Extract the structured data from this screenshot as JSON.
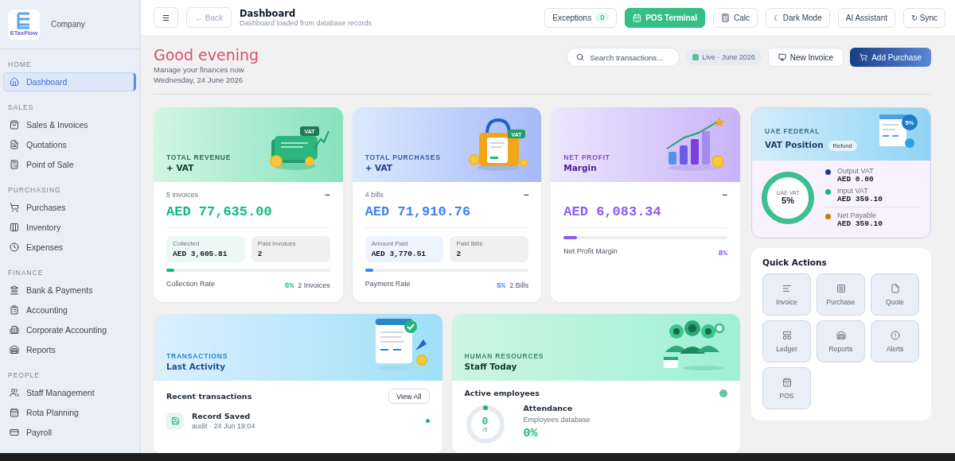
{
  "sidebar": {
    "logo_text": "ETaxFlow",
    "company": "Company",
    "sections": [
      {
        "label": "HOME",
        "items": [
          {
            "label": "Dashboard",
            "selected": true
          }
        ]
      },
      {
        "label": "SALES",
        "items": [
          {
            "label": "Sales & Invoices",
            "selected": false
          },
          {
            "label": "Quotations",
            "selected": false
          },
          {
            "label": "Point of Sale",
            "selected": false
          }
        ]
      },
      {
        "label": "PURCHASING",
        "items": [
          {
            "label": "Purchases",
            "selected": false
          },
          {
            "label": "Inventory",
            "selected": false
          },
          {
            "label": "Expenses",
            "selected": false
          }
        ]
      },
      {
        "label": "FINANCE",
        "items": [
          {
            "label": "Bank & Payments",
            "selected": false
          },
          {
            "label": "Accounting",
            "selected": false
          },
          {
            "label": "Corporate Accounting",
            "selected": false
          },
          {
            "label": "Reports",
            "selected": false
          }
        ]
      },
      {
        "label": "PEOPLE",
        "items": [
          {
            "label": "Staff Management",
            "selected": false
          },
          {
            "label": "Rota Planning",
            "selected": false
          },
          {
            "label": "Payroll",
            "selected": false
          }
        ]
      }
    ]
  },
  "topbar": {
    "menu": "☰",
    "back": "← Back",
    "title": "Dashboard",
    "subtitle": "Dashboard loaded from database records",
    "buttons": [
      {
        "label": "Exceptions",
        "kind": "outline",
        "badge": "0"
      },
      {
        "label": "POS Terminal",
        "kind": "primary"
      },
      {
        "label": "Calc",
        "kind": "outline"
      },
      {
        "label": "☾ Dark Mode",
        "kind": "outline"
      },
      {
        "label": "AI Assistant",
        "kind": "outline"
      },
      {
        "label": "↻ Sync",
        "kind": "outline"
      }
    ]
  },
  "greeting": {
    "title": "Good evening",
    "subtitle": "Manage your finances now",
    "date": "Wednesday, 24 June 2026"
  },
  "actions": {
    "search_placeholder": "Search transactions...",
    "live": "Live · June 2026",
    "new_invoice": "New Invoice",
    "add_purchase": "Add Purchase"
  },
  "stat_cards": [
    {
      "kind": "revenue",
      "eyebrow": "TOTAL REVENUE",
      "title": "+ VAT",
      "tag": "VAT",
      "count": "5 invoices",
      "toggle": "−",
      "value": "AED 77,635.00",
      "color": "#10b981",
      "tiles": [
        {
          "label": "Collected",
          "value": "AED 3,605.81"
        },
        {
          "label": "Paid Invoices",
          "value": "2"
        }
      ],
      "progress": {
        "level": 0.05,
        "label": "Collection Rate",
        "percent": "5%",
        "note": "2 Invoices"
      }
    },
    {
      "kind": "purchases",
      "eyebrow": "TOTAL PURCHASES",
      "title": "+ VAT",
      "tag": "VAT",
      "count": "4 bills",
      "toggle": "−",
      "value": "AED 71,910.76",
      "color": "#3b82f6",
      "tiles": [
        {
          "label": "Amount Paid",
          "value": "AED 3,770.51"
        },
        {
          "label": "Paid Bills",
          "value": "2"
        }
      ],
      "progress": {
        "level": 0.05,
        "label": "Payment Rate",
        "percent": "5%",
        "note": "2 Bills"
      }
    },
    {
      "kind": "profit",
      "eyebrow": "NET PROFIT",
      "title": "Margin",
      "toggle": "−",
      "value": "AED 6,083.34",
      "color": "#8b5cf6",
      "progress": {
        "level": 0.08,
        "label": "Net Profit Margin",
        "percent": "8%"
      }
    }
  ],
  "vat": {
    "eyebrow": "UAE FEDERAL",
    "title": "VAT Position",
    "badge": "Refund",
    "tag": "5%",
    "ring_label": "UAE VAT",
    "ring_value": "5%",
    "legend": [
      {
        "label": "Output VAT",
        "value": "AED 0.00",
        "color": "#1e3a8a"
      },
      {
        "label": "Input VAT",
        "value": "AED 359.10",
        "color": "#10b981"
      },
      {
        "label": "Net Payable",
        "value": "AED 359.10",
        "color": "#d97706"
      }
    ]
  },
  "quick_actions": {
    "title": "Quick Actions",
    "items": [
      "Invoice",
      "Purchase",
      "Quote",
      "Ledger",
      "Reports",
      "Alerts",
      "POS"
    ]
  },
  "transactions": {
    "eyebrow": "TRANSACTIONS",
    "title": "Last Activity",
    "heading": "Recent transactions",
    "view_all": "View All",
    "items": [
      {
        "title": "Record Saved",
        "meta": "audit · 24 Jun 19:04",
        "color": "#10b981"
      }
    ]
  },
  "hr": {
    "eyebrow": "HUMAN RESOURCES",
    "title": "Staff Today",
    "heading": "Active employees",
    "status": {
      "color": "#6cc4a4"
    },
    "ring_value": "0",
    "ring_total": "/0",
    "level": 0,
    "attendance": "Attendance",
    "source": "Employees database",
    "percent": "0%"
  }
}
